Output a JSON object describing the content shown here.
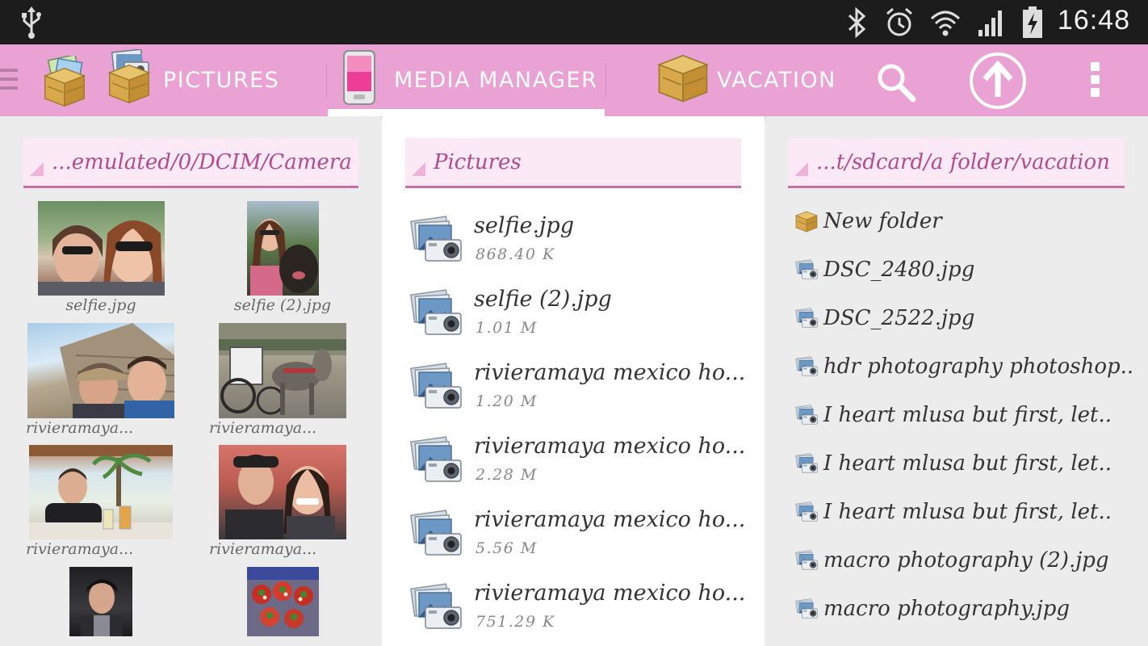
{
  "status_bar": {
    "time": "16:48",
    "icons": [
      "usb-icon",
      "bluetooth-icon",
      "alarm-icon",
      "wifi-icon",
      "signal-icon",
      "battery-charging-icon"
    ]
  },
  "action_bar": {
    "tabs": [
      {
        "label": "PICTURES",
        "icon": "box-photo-icon"
      },
      {
        "label": "MEDIA MANAGER",
        "icon": "phone-icon",
        "active": true
      },
      {
        "label": "VACATION",
        "icon": "box-icon"
      }
    ],
    "actions": [
      "search-icon",
      "arrow-up-icon",
      "overflow-menu-icon"
    ]
  },
  "left_pane": {
    "path": "...emulated/0/DCIM/Camera",
    "items": [
      {
        "caption": "selfie.jpg"
      },
      {
        "caption": "selfie (2).jpg"
      },
      {
        "caption": "rivieramaya..."
      },
      {
        "caption": "rivieramaya..."
      },
      {
        "caption": "rivieramaya..."
      },
      {
        "caption": "rivieramaya..."
      },
      {
        "caption": ""
      },
      {
        "caption": ""
      }
    ]
  },
  "middle_pane": {
    "path": "Pictures",
    "files": [
      {
        "name": "selfie.jpg",
        "size": "868.40 K"
      },
      {
        "name": "selfie (2).jpg",
        "size": "1.01 M"
      },
      {
        "name": "rivieramaya mexico ho...",
        "size": "1.20 M"
      },
      {
        "name": "rivieramaya mexico ho...",
        "size": "2.28 M"
      },
      {
        "name": "rivieramaya mexico ho...",
        "size": "5.56 M"
      },
      {
        "name": "rivieramaya mexico ho...",
        "size": "751.29 K"
      }
    ]
  },
  "right_pane": {
    "path": "...t/sdcard/a folder/vacation",
    "items": [
      {
        "name": "New folder",
        "type": "folder"
      },
      {
        "name": "DSC_2480.jpg",
        "type": "image"
      },
      {
        "name": "DSC_2522.jpg",
        "type": "image"
      },
      {
        "name": "hdr photography photoshop..",
        "type": "image"
      },
      {
        "name": "I heart mlusa but first, let..",
        "type": "image"
      },
      {
        "name": "I heart mlusa but first, let..",
        "type": "image"
      },
      {
        "name": "I heart mlusa but first, let..",
        "type": "image"
      },
      {
        "name": "macro photography (2).jpg",
        "type": "image"
      },
      {
        "name": "macro photography.jpg",
        "type": "image"
      }
    ]
  },
  "colors": {
    "accent": "#e9a2d3",
    "header_text": "#b04d8e",
    "header_bg": "#fbe9f5"
  }
}
